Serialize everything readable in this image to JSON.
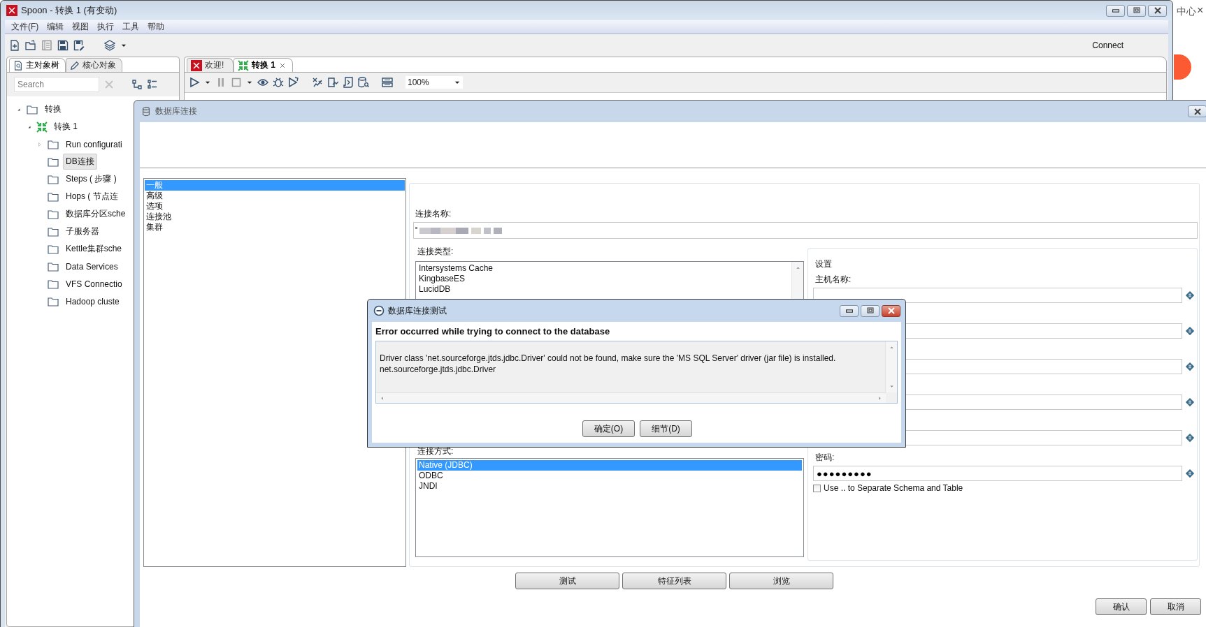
{
  "window": {
    "title": "Spoon - 转换 1 (有变动)"
  },
  "menu": [
    "文件(F)",
    "编辑",
    "视图",
    "执行",
    "工具",
    "帮助"
  ],
  "toolbar": {
    "connect": "Connect"
  },
  "left_panel": {
    "tabs": [
      {
        "label": "主对象树",
        "selected": true
      },
      {
        "label": "核心对象",
        "selected": false
      }
    ],
    "search": {
      "placeholder": "Search"
    },
    "tree": [
      {
        "label": "转换",
        "kind": "folder",
        "selected": false,
        "expanded": true,
        "children": [
          {
            "label": "转换 1",
            "kind": "transformation",
            "selected": false,
            "expanded": true,
            "children": [
              {
                "label": "Run configurati",
                "kind": "folder",
                "selected": false,
                "expanded": false
              },
              {
                "label": "DB连接",
                "kind": "folder",
                "selected": true
              },
              {
                "label": "Steps ( 步骤 )",
                "kind": "folder",
                "selected": false
              },
              {
                "label": "Hops ( 节点连",
                "kind": "folder",
                "selected": false
              },
              {
                "label": "数据库分区sche",
                "kind": "folder",
                "selected": false
              },
              {
                "label": "子服务器",
                "kind": "folder",
                "selected": false
              },
              {
                "label": "Kettle集群sche",
                "kind": "folder",
                "selected": false
              },
              {
                "label": "Data Services",
                "kind": "folder",
                "selected": false
              },
              {
                "label": "VFS Connectio",
                "kind": "folder",
                "selected": false
              },
              {
                "label": "Hadoop cluste",
                "kind": "folder",
                "selected": false
              }
            ]
          }
        ]
      }
    ]
  },
  "editor": {
    "tabs": [
      {
        "label": "欢迎!",
        "kind": "welcome",
        "selected": false,
        "closable": false
      },
      {
        "label": "转换 1",
        "kind": "transformation",
        "selected": true,
        "closable": true
      }
    ],
    "zoom": "100%"
  },
  "db_dialog": {
    "title": "数据库连接",
    "sections": [
      {
        "label": "一般",
        "selected": true
      },
      {
        "label": "高级",
        "selected": false
      },
      {
        "label": "选项",
        "selected": false
      },
      {
        "label": "连接池",
        "selected": false
      },
      {
        "label": "集群",
        "selected": false
      }
    ],
    "connection_name": {
      "label": "连接名称:"
    },
    "connection_type": {
      "label": "连接类型:",
      "items": [
        {
          "label": "Intersystems Cache",
          "selected": false
        },
        {
          "label": "KingbaseES",
          "selected": false
        },
        {
          "label": "LucidDB",
          "selected": false
        }
      ]
    },
    "access": {
      "label": "连接方式:",
      "items": [
        {
          "label": "Native (JDBC)",
          "selected": true
        },
        {
          "label": "ODBC",
          "selected": false
        },
        {
          "label": "JNDI",
          "selected": false
        }
      ]
    },
    "settings": {
      "title": "设置",
      "fields": [
        {
          "label": "主机名称:",
          "variable": true
        },
        {
          "variable": true
        },
        {
          "variable": true
        },
        {
          "variable": true
        },
        {
          "variable": true
        },
        {
          "label": "密码:",
          "value": "●●●●●●●●●",
          "variable": true
        }
      ],
      "checkbox": {
        "label": "Use .. to Separate Schema and Table",
        "checked": false
      }
    },
    "buttons": [
      "测试",
      "特征列表",
      "浏览"
    ],
    "footer_buttons": [
      "确认",
      "取消"
    ]
  },
  "test_dialog": {
    "title": "数据库连接测试",
    "heading": "Error occurred while trying to connect to the database",
    "message": [
      "Driver class 'net.sourceforge.jtds.jdbc.Driver' could not be found, make sure the 'MS SQL Server' driver (jar file) is installed.",
      "net.sourceforge.jtds.jdbc.Driver"
    ],
    "buttons": [
      "确定(O)",
      "细节(D)"
    ]
  },
  "background_page": {
    "text": "中心",
    "close": "×"
  }
}
